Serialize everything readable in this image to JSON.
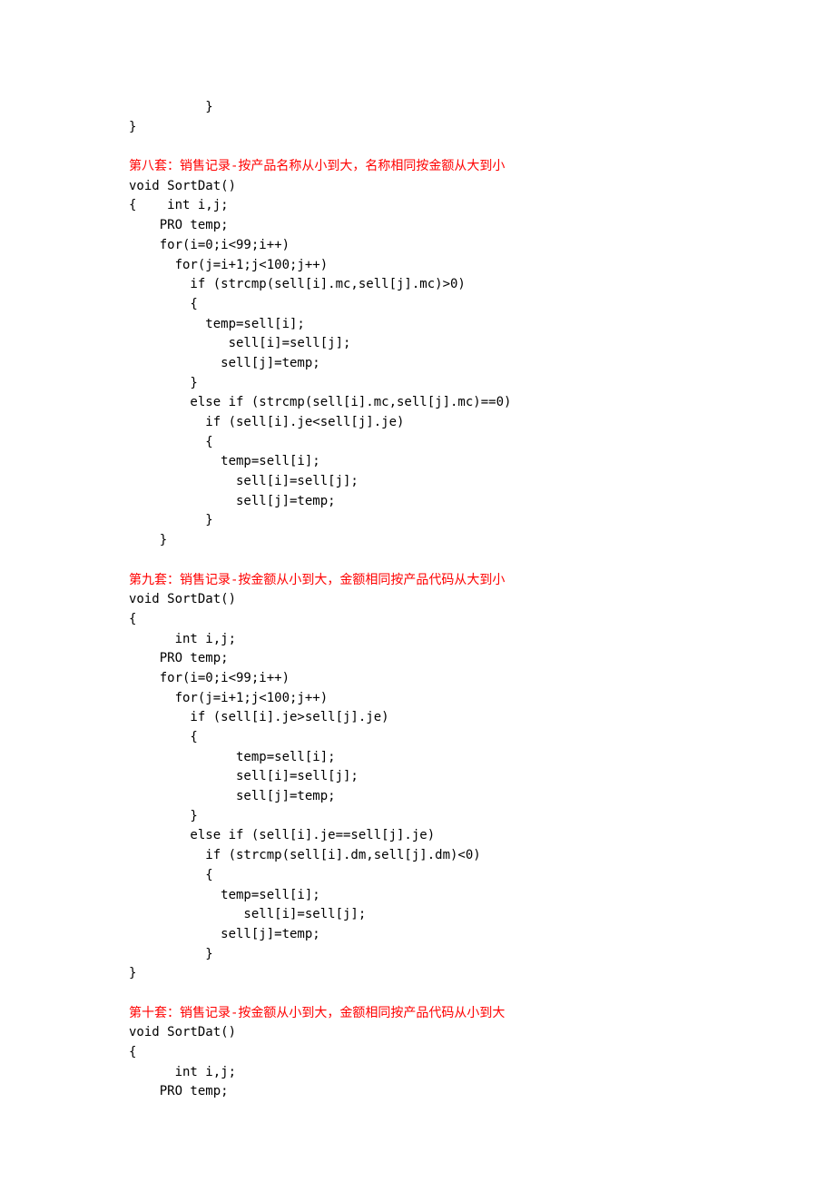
{
  "lines": [
    {
      "text": "          }",
      "red": false
    },
    {
      "text": "}",
      "red": false
    },
    {
      "text": "",
      "red": false
    },
    {
      "text": "第八套：销售记录-按产品名称从小到大，名称相同按金额从大到小",
      "red": true
    },
    {
      "text": "void SortDat()",
      "red": false
    },
    {
      "text": "{    int i,j;",
      "red": false
    },
    {
      "text": "    PRO temp;",
      "red": false
    },
    {
      "text": "    for(i=0;i<99;i++)",
      "red": false
    },
    {
      "text": "      for(j=i+1;j<100;j++)",
      "red": false
    },
    {
      "text": "        if (strcmp(sell[i].mc,sell[j].mc)>0)",
      "red": false
    },
    {
      "text": "        {",
      "red": false
    },
    {
      "text": "          temp=sell[i];",
      "red": false
    },
    {
      "text": "             sell[i]=sell[j];",
      "red": false
    },
    {
      "text": "            sell[j]=temp;",
      "red": false
    },
    {
      "text": "        }",
      "red": false
    },
    {
      "text": "        else if (strcmp(sell[i].mc,sell[j].mc)==0)",
      "red": false
    },
    {
      "text": "          if (sell[i].je<sell[j].je)",
      "red": false
    },
    {
      "text": "          {",
      "red": false
    },
    {
      "text": "            temp=sell[i];",
      "red": false
    },
    {
      "text": "              sell[i]=sell[j];",
      "red": false
    },
    {
      "text": "              sell[j]=temp;",
      "red": false
    },
    {
      "text": "          }",
      "red": false
    },
    {
      "text": "    }",
      "red": false
    },
    {
      "text": "",
      "red": false
    },
    {
      "text": "第九套：销售记录-按金额从小到大，金额相同按产品代码从大到小",
      "red": true
    },
    {
      "text": "void SortDat()",
      "red": false
    },
    {
      "text": "{",
      "red": false
    },
    {
      "text": "      int i,j;",
      "red": false
    },
    {
      "text": "    PRO temp;",
      "red": false
    },
    {
      "text": "    for(i=0;i<99;i++)",
      "red": false
    },
    {
      "text": "      for(j=i+1;j<100;j++)",
      "red": false
    },
    {
      "text": "        if (sell[i].je>sell[j].je)",
      "red": false
    },
    {
      "text": "        {",
      "red": false
    },
    {
      "text": "              temp=sell[i];",
      "red": false
    },
    {
      "text": "              sell[i]=sell[j];",
      "red": false
    },
    {
      "text": "              sell[j]=temp;",
      "red": false
    },
    {
      "text": "        }",
      "red": false
    },
    {
      "text": "        else if (sell[i].je==sell[j].je)",
      "red": false
    },
    {
      "text": "          if (strcmp(sell[i].dm,sell[j].dm)<0)",
      "red": false
    },
    {
      "text": "          {",
      "red": false
    },
    {
      "text": "            temp=sell[i];",
      "red": false
    },
    {
      "text": "               sell[i]=sell[j];",
      "red": false
    },
    {
      "text": "            sell[j]=temp;",
      "red": false
    },
    {
      "text": "          }",
      "red": false
    },
    {
      "text": "}",
      "red": false
    },
    {
      "text": "",
      "red": false
    },
    {
      "text": "第十套：销售记录-按金额从小到大，金额相同按产品代码从小到大",
      "red": true
    },
    {
      "text": "void SortDat()",
      "red": false
    },
    {
      "text": "{",
      "red": false
    },
    {
      "text": "      int i,j;",
      "red": false
    },
    {
      "text": "    PRO temp;",
      "red": false
    }
  ]
}
